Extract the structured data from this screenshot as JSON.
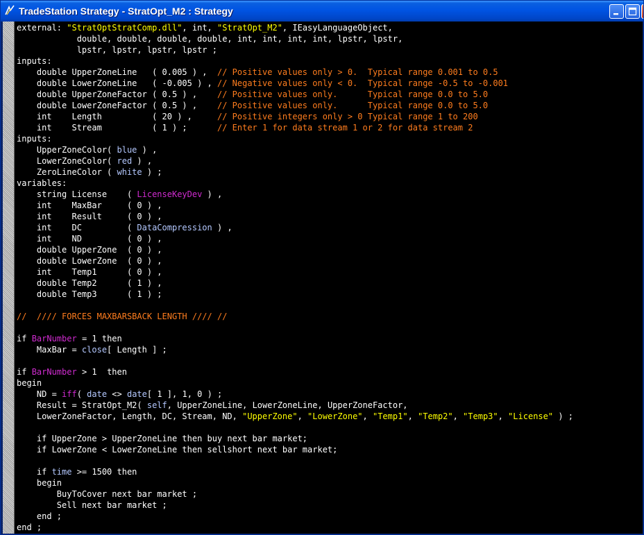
{
  "window": {
    "title": "TradeStation Strategy - StratOpt_M2 : Strategy"
  },
  "code_lines": [
    [
      {
        "t": "external: ",
        "c": "kw"
      },
      {
        "t": "\"StratOptStratComp.dll\"",
        "c": "st"
      },
      {
        "t": ", int, ",
        "c": "kw"
      },
      {
        "t": "\"StratOpt_M2\"",
        "c": "st"
      },
      {
        "t": ", IEasyLanguageObject,",
        "c": "kw"
      }
    ],
    [
      {
        "t": "            double, double, double, double, int, int, int, int, lpstr, lpstr,",
        "c": "kw"
      }
    ],
    [
      {
        "t": "            lpstr, lpstr, lpstr, lpstr ;",
        "c": "kw"
      }
    ],
    [
      {
        "t": "inputs:",
        "c": "kw"
      }
    ],
    [
      {
        "t": "    double UpperZoneLine   ( 0.005 ) ,  ",
        "c": "kw"
      },
      {
        "t": "// Positive values only > 0.  Typical range 0.001 to 0.5",
        "c": "cm"
      }
    ],
    [
      {
        "t": "    double LowerZoneLine   ( -0.005 ) , ",
        "c": "kw"
      },
      {
        "t": "// Negative values only < 0.  Typical range -0.5 to -0.001",
        "c": "cm"
      }
    ],
    [
      {
        "t": "    double UpperZoneFactor ( 0.5 ) ,    ",
        "c": "kw"
      },
      {
        "t": "// Positive values only.      Typical range 0.0 to 5.0",
        "c": "cm"
      }
    ],
    [
      {
        "t": "    double LowerZoneFactor ( 0.5 ) ,    ",
        "c": "kw"
      },
      {
        "t": "// Positive values only.      Typical range 0.0 to 5.0",
        "c": "cm"
      }
    ],
    [
      {
        "t": "    int    Length          ( 20 ) ,     ",
        "c": "kw"
      },
      {
        "t": "// Positive integers only > 0 Typical range 1 to 200",
        "c": "cm"
      }
    ],
    [
      {
        "t": "    int    Stream          ( 1 ) ;      ",
        "c": "kw"
      },
      {
        "t": "// Enter 1 for data stream 1 or 2 for data stream 2",
        "c": "cm"
      }
    ],
    [
      {
        "t": "inputs:",
        "c": "kw"
      }
    ],
    [
      {
        "t": "    UpperZoneColor( ",
        "c": "kw"
      },
      {
        "t": "blue",
        "c": "cl"
      },
      {
        "t": " ) ,",
        "c": "kw"
      }
    ],
    [
      {
        "t": "    LowerZoneColor( ",
        "c": "kw"
      },
      {
        "t": "red",
        "c": "cl"
      },
      {
        "t": " ) ,",
        "c": "kw"
      }
    ],
    [
      {
        "t": "    ZeroLineColor ( ",
        "c": "kw"
      },
      {
        "t": "white",
        "c": "cl"
      },
      {
        "t": " ) ;",
        "c": "kw"
      }
    ],
    [
      {
        "t": "variables:",
        "c": "kw"
      }
    ],
    [
      {
        "t": "    string License    ( ",
        "c": "kw"
      },
      {
        "t": "LicenseKeyDev",
        "c": "rs"
      },
      {
        "t": " ) ,",
        "c": "kw"
      }
    ],
    [
      {
        "t": "    int    MaxBar     ( 0 ) ,",
        "c": "kw"
      }
    ],
    [
      {
        "t": "    int    Result     ( 0 ) ,",
        "c": "kw"
      }
    ],
    [
      {
        "t": "    int    DC         ( ",
        "c": "kw"
      },
      {
        "t": "DataCompression",
        "c": "cl"
      },
      {
        "t": " ) ,",
        "c": "kw"
      }
    ],
    [
      {
        "t": "    int    ND         ( 0 ) ,",
        "c": "kw"
      }
    ],
    [
      {
        "t": "    double UpperZone  ( 0 ) ,",
        "c": "kw"
      }
    ],
    [
      {
        "t": "    double LowerZone  ( 0 ) ,",
        "c": "kw"
      }
    ],
    [
      {
        "t": "    int    Temp1      ( 0 ) ,",
        "c": "kw"
      }
    ],
    [
      {
        "t": "    double Temp2      ( 1 ) ,",
        "c": "kw"
      }
    ],
    [
      {
        "t": "    double Temp3      ( 1 ) ;",
        "c": "kw"
      }
    ],
    [
      {
        "t": "",
        "c": "kw"
      }
    ],
    [
      {
        "t": "//  //// FORCES MAXBARSBACK LENGTH //// //",
        "c": "cm"
      }
    ],
    [
      {
        "t": "",
        "c": "kw"
      }
    ],
    [
      {
        "t": "if ",
        "c": "kw"
      },
      {
        "t": "BarNumber",
        "c": "rs"
      },
      {
        "t": " = 1 then",
        "c": "kw"
      }
    ],
    [
      {
        "t": "    MaxBar = ",
        "c": "kw"
      },
      {
        "t": "close",
        "c": "cl"
      },
      {
        "t": "[ Length ] ;",
        "c": "kw"
      }
    ],
    [
      {
        "t": "",
        "c": "kw"
      }
    ],
    [
      {
        "t": "if ",
        "c": "kw"
      },
      {
        "t": "BarNumber",
        "c": "rs"
      },
      {
        "t": " > 1  then",
        "c": "kw"
      }
    ],
    [
      {
        "t": "begin",
        "c": "kw"
      }
    ],
    [
      {
        "t": "    ND = ",
        "c": "kw"
      },
      {
        "t": "iff",
        "c": "rs"
      },
      {
        "t": "( ",
        "c": "kw"
      },
      {
        "t": "date",
        "c": "cl"
      },
      {
        "t": " <> ",
        "c": "kw"
      },
      {
        "t": "date",
        "c": "cl"
      },
      {
        "t": "[ 1 ], 1, 0 ) ;",
        "c": "kw"
      }
    ],
    [
      {
        "t": "    Result = StratOpt_M2( ",
        "c": "kw"
      },
      {
        "t": "self",
        "c": "cl"
      },
      {
        "t": ", UpperZoneLine, LowerZoneLine, UpperZoneFactor,",
        "c": "kw"
      }
    ],
    [
      {
        "t": "    LowerZoneFactor, Length, DC, Stream, ND, ",
        "c": "kw"
      },
      {
        "t": "\"UpperZone\"",
        "c": "st"
      },
      {
        "t": ", ",
        "c": "kw"
      },
      {
        "t": "\"LowerZone\"",
        "c": "st"
      },
      {
        "t": ", ",
        "c": "kw"
      },
      {
        "t": "\"Temp1\"",
        "c": "st"
      },
      {
        "t": ", ",
        "c": "kw"
      },
      {
        "t": "\"Temp2\"",
        "c": "st"
      },
      {
        "t": ", ",
        "c": "kw"
      },
      {
        "t": "\"Temp3\"",
        "c": "st"
      },
      {
        "t": ", ",
        "c": "kw"
      },
      {
        "t": "\"License\"",
        "c": "st"
      },
      {
        "t": " ) ;",
        "c": "kw"
      }
    ],
    [
      {
        "t": "",
        "c": "kw"
      }
    ],
    [
      {
        "t": "    if UpperZone > UpperZoneLine then buy next bar market;",
        "c": "kw"
      }
    ],
    [
      {
        "t": "    if LowerZone < LowerZoneLine then sellshort next bar market;",
        "c": "kw"
      }
    ],
    [
      {
        "t": "",
        "c": "kw"
      }
    ],
    [
      {
        "t": "    if ",
        "c": "kw"
      },
      {
        "t": "time",
        "c": "cl"
      },
      {
        "t": " >= 1500 then",
        "c": "kw"
      }
    ],
    [
      {
        "t": "    begin",
        "c": "kw"
      }
    ],
    [
      {
        "t": "        BuyToCover next bar market ;",
        "c": "kw"
      }
    ],
    [
      {
        "t": "        Sell next bar market ;",
        "c": "kw"
      }
    ],
    [
      {
        "t": "    end ;",
        "c": "kw"
      }
    ],
    [
      {
        "t": "end ;",
        "c": "kw"
      }
    ]
  ]
}
